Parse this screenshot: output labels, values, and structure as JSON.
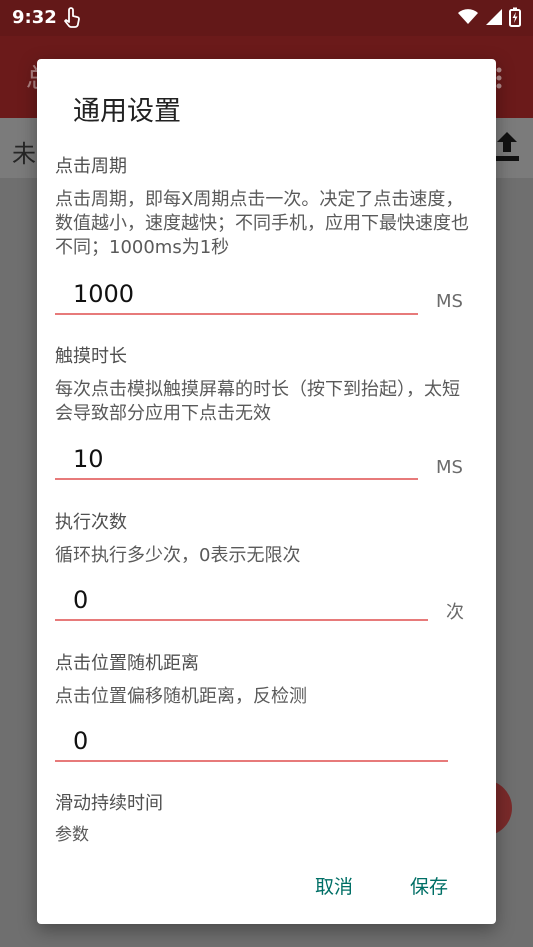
{
  "status": {
    "time": "9:32",
    "icons": [
      "touch-hand-icon",
      "wifi-icon",
      "signal-icon",
      "battery-icon"
    ]
  },
  "appbar": {
    "title_partial": "总",
    "under_text": "未"
  },
  "dialog": {
    "title": "通用设置",
    "sections": [
      {
        "heading": "点击周期",
        "desc": "点击周期，即每X周期点击一次。决定了点击速度，数值越小，速度越快；不同手机，应用下最快速度也不同；1000ms为1秒",
        "value": "1000",
        "unit": "MS"
      },
      {
        "heading": "触摸时长",
        "desc": "每次点击模拟触摸屏幕的时长（按下到抬起），太短会导致部分应用下点击无效",
        "value": "10",
        "unit": "MS"
      },
      {
        "heading": "执行次数",
        "desc": "循环执行多少次，0表示无限次",
        "value": "0",
        "unit": "次"
      },
      {
        "heading": "点击位置随机距离",
        "desc": "点击位置偏移随机距离，反检测",
        "value": "0",
        "unit": ""
      },
      {
        "heading": "滑动持续时间",
        "desc": "参数"
      }
    ],
    "buttons": {
      "cancel": "取消",
      "save": "保存"
    }
  },
  "colors": {
    "statusbar": "#631818",
    "accent_underline": "#e77a7a",
    "button_text": "#006f66"
  }
}
